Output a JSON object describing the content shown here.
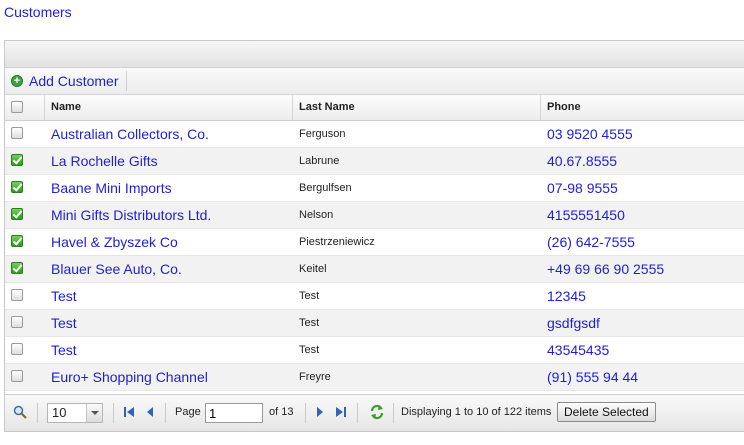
{
  "page": {
    "title": "Customers"
  },
  "toolbar": {
    "add_label": "Add Customer"
  },
  "table": {
    "columns": [
      "Name",
      "Last Name",
      "Phone"
    ],
    "rows": [
      {
        "checked": false,
        "name": "Australian Collectors, Co.",
        "last_name": "Ferguson",
        "phone": "03 9520 4555"
      },
      {
        "checked": true,
        "name": "La Rochelle Gifts",
        "last_name": "Labrune",
        "phone": "40.67.8555"
      },
      {
        "checked": true,
        "name": "Baane Mini Imports",
        "last_name": "Bergulfsen",
        "phone": "07-98 9555"
      },
      {
        "checked": true,
        "name": "Mini Gifts Distributors Ltd.",
        "last_name": "Nelson",
        "phone": "4155551450"
      },
      {
        "checked": true,
        "name": "Havel & Zbyszek Co",
        "last_name": "Piestrzeniewicz",
        "phone": "(26) 642-7555"
      },
      {
        "checked": true,
        "name": "Blauer See Auto, Co.",
        "last_name": "Keitel",
        "phone": "+49 69 66 90 2555"
      },
      {
        "checked": false,
        "name": "Test",
        "last_name": "Test",
        "phone": "12345"
      },
      {
        "checked": false,
        "name": "Test",
        "last_name": "Test",
        "phone": "gsdfgsdf"
      },
      {
        "checked": false,
        "name": "Test",
        "last_name": "Test",
        "phone": "43545435"
      },
      {
        "checked": false,
        "name": "Euro+ Shopping Channel",
        "last_name": "Freyre",
        "phone": "(91) 555 94 44"
      }
    ]
  },
  "pager": {
    "page_size": "10",
    "page_label": "Page",
    "current_page": "1",
    "of_pages": "of 13",
    "display_text": "Displaying 1 to 10 of 122 items",
    "delete_label": "Delete Selected"
  },
  "icons": [
    "search-icon",
    "first-page-icon",
    "prev-page-icon",
    "next-page-icon",
    "last-page-icon",
    "refresh-icon",
    "add-icon"
  ],
  "colors": {
    "link": "#1f1fd1",
    "check": "#2e9a1e"
  }
}
